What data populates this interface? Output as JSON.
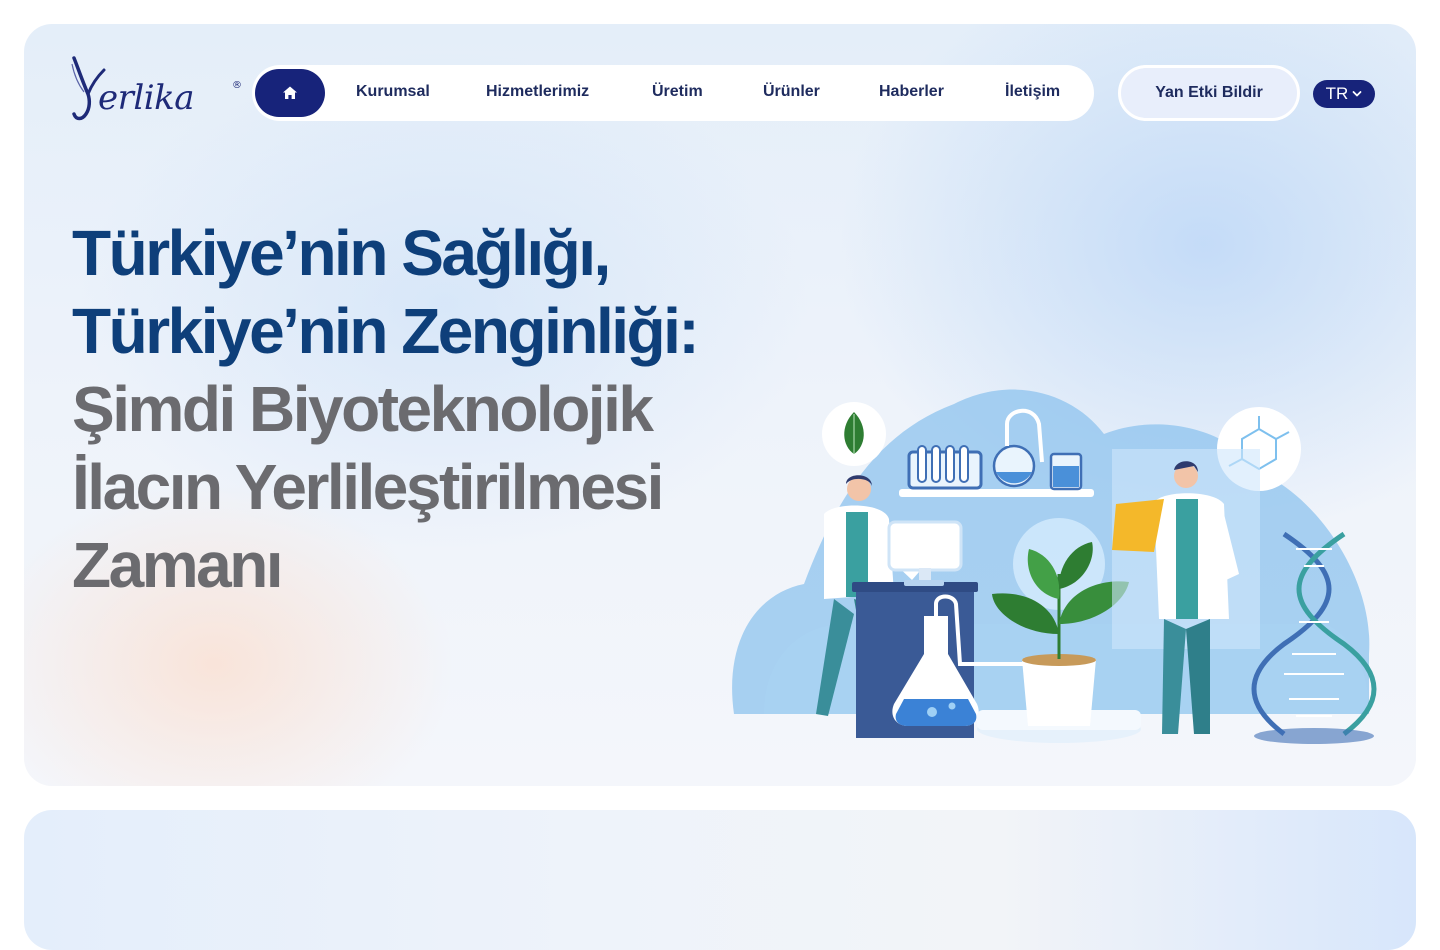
{
  "logo": {
    "text": "erlika",
    "mark": "Y",
    "registered": "®"
  },
  "nav": {
    "home_icon": "home-icon",
    "items": [
      "Kurumsal",
      "Hizmetlerimiz",
      "Üretim",
      "Ürünler",
      "Haberler",
      "İletişim"
    ]
  },
  "report_button": "Yan Etki Bildir",
  "language": {
    "selected": "TR",
    "icon": "chevron-down-icon"
  },
  "hero": {
    "headline_lines": [
      "Türkiye’nin Sağlığı,",
      "Türkiye’nin Zenginliği:",
      "Şimdi Biyoteknolojik",
      "İlacın Yerlileştirilmesi",
      "Zamanı"
    ],
    "illustration": "laboratory-scientists-illustration"
  },
  "colors": {
    "brand_navy": "#17237a",
    "headline_blue": "#0e3f7a",
    "headline_grey": "#6b6b6f",
    "nav_text": "#1e2b5e"
  }
}
